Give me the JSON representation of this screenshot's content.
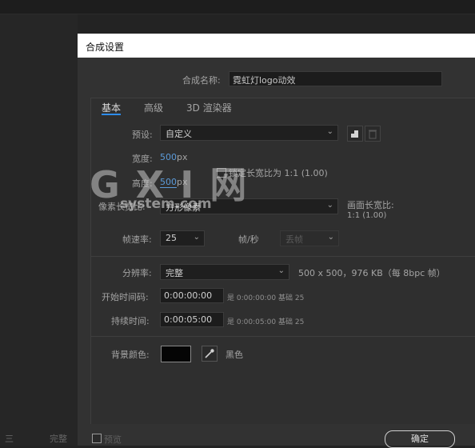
{
  "background": {
    "footer_items": [
      "三",
      "完整"
    ]
  },
  "dialog": {
    "title": "合成设置",
    "comp_name_label": "合成名称:",
    "comp_name_value": "霓虹灯logo动效",
    "tabs": [
      {
        "label": "基本",
        "active": true
      },
      {
        "label": "高级",
        "active": false
      },
      {
        "label": "3D 渲染器",
        "active": false
      }
    ],
    "preset": {
      "label": "预设:",
      "value": "自定义",
      "icons": [
        "new-preset-icon",
        "delete-preset-icon"
      ]
    },
    "width": {
      "label": "宽度:",
      "value": "500",
      "unit": "px"
    },
    "height": {
      "label": "高度:",
      "value": "500",
      "unit": "px"
    },
    "lock_aspect": {
      "label": "锁定长宽比为 1:1 (1.00)",
      "checked": false
    },
    "pixel_aspect": {
      "label": "像素长宽比:",
      "value": "方形像素"
    },
    "frame_aspect": {
      "label": "画面长宽比:",
      "value": "1:1 (1.00)"
    },
    "frame_rate": {
      "label": "帧速率:",
      "value": "25",
      "unit": "帧/秒",
      "secondary_value": "丢帧"
    },
    "resolution": {
      "label": "分辨率:",
      "value": "完整",
      "info": "500 x 500，976 KB（每 8bpc 帧）"
    },
    "start_timecode": {
      "label": "开始时间码:",
      "value": "0:00:00:00",
      "note": "是 0:00:00:00",
      "base": "基础 25"
    },
    "duration": {
      "label": "持续时间:",
      "value": "0:00:05:00",
      "note": "是 0:00:05:00",
      "base": "基础 25"
    },
    "bg_color": {
      "label": "背景颜色:",
      "color": "#050505",
      "name": "黑色"
    },
    "preview": {
      "label": "预览",
      "checked": false
    },
    "ok_label": "确定"
  },
  "watermark": {
    "logo": "G X I 网",
    "url": "system.com"
  },
  "colors": {
    "accent": "#2d8ceb",
    "value_blue": "#5b9ad8",
    "dialog_bg": "#323232"
  }
}
